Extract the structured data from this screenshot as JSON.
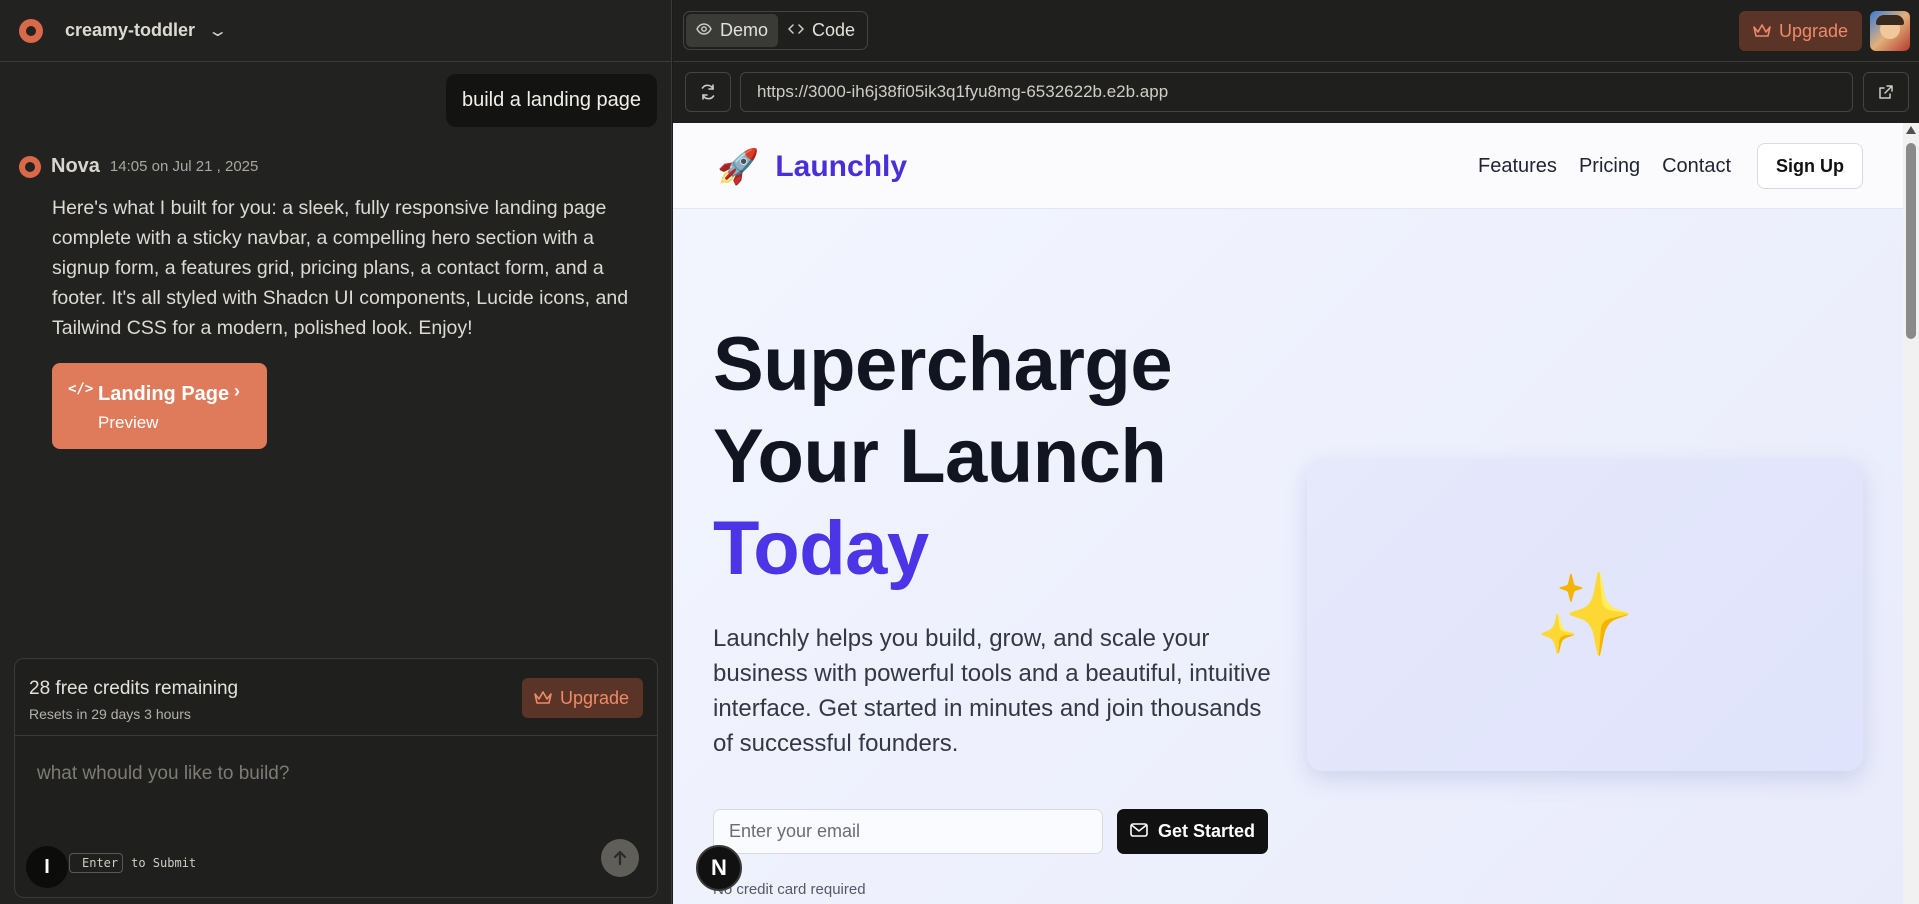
{
  "left": {
    "project_name": "creamy-toddler",
    "user_message": "build a landing page",
    "assistant": {
      "name": "Nova",
      "time": "14:05 on Jul 21 , 2025",
      "body": "Here's what I built for you: a sleek, fully responsive landing page complete with a sticky navbar, a compelling hero section with a signup form, a features grid, pricing plans, a contact form, and a footer. It's all styled with Shadcn UI components, Lucide icons, and Tailwind CSS for a modern, polished look. Enjoy!"
    },
    "preview_card": {
      "title": "Landing Page",
      "subtitle": "Preview",
      "code_icon": "</>"
    },
    "composer": {
      "credits": "28 free credits remaining",
      "resets": "Resets in 29 days 3 hours",
      "upgrade_label": "Upgrade",
      "placeholder": "what whould you like to build?",
      "kbd": "Enter",
      "hint": "to Submit"
    },
    "i_badge": "I"
  },
  "right": {
    "tabs": [
      {
        "label": "Demo",
        "icon": "eye-icon"
      },
      {
        "label": "Code",
        "icon": "code-icon"
      }
    ],
    "upgrade_label": "Upgrade",
    "url": "https://3000-ih6j38fi05ik3q1fyu8mg-6532622b.e2b.app"
  },
  "site": {
    "brand": "Launchly",
    "rocket": "🚀",
    "nav": [
      "Features",
      "Pricing",
      "Contact"
    ],
    "signup": "Sign Up",
    "hero_line1": "Supercharge",
    "hero_line2": "Your Launch",
    "hero_line3": "Today",
    "description": "Launchly helps you build, grow, and scale your business with powerful tools and a beautiful, intuitive interface. Get started in minutes and join thousands of successful founders.",
    "email_placeholder": "Enter your email",
    "cta": "Get Started",
    "note": "No credit card required",
    "sparkles": "✨",
    "n_badge": "N"
  },
  "colors": {
    "accent": "#df7b5b",
    "brand": "#4b35e6",
    "upgrade_text": "#ee8a68"
  }
}
